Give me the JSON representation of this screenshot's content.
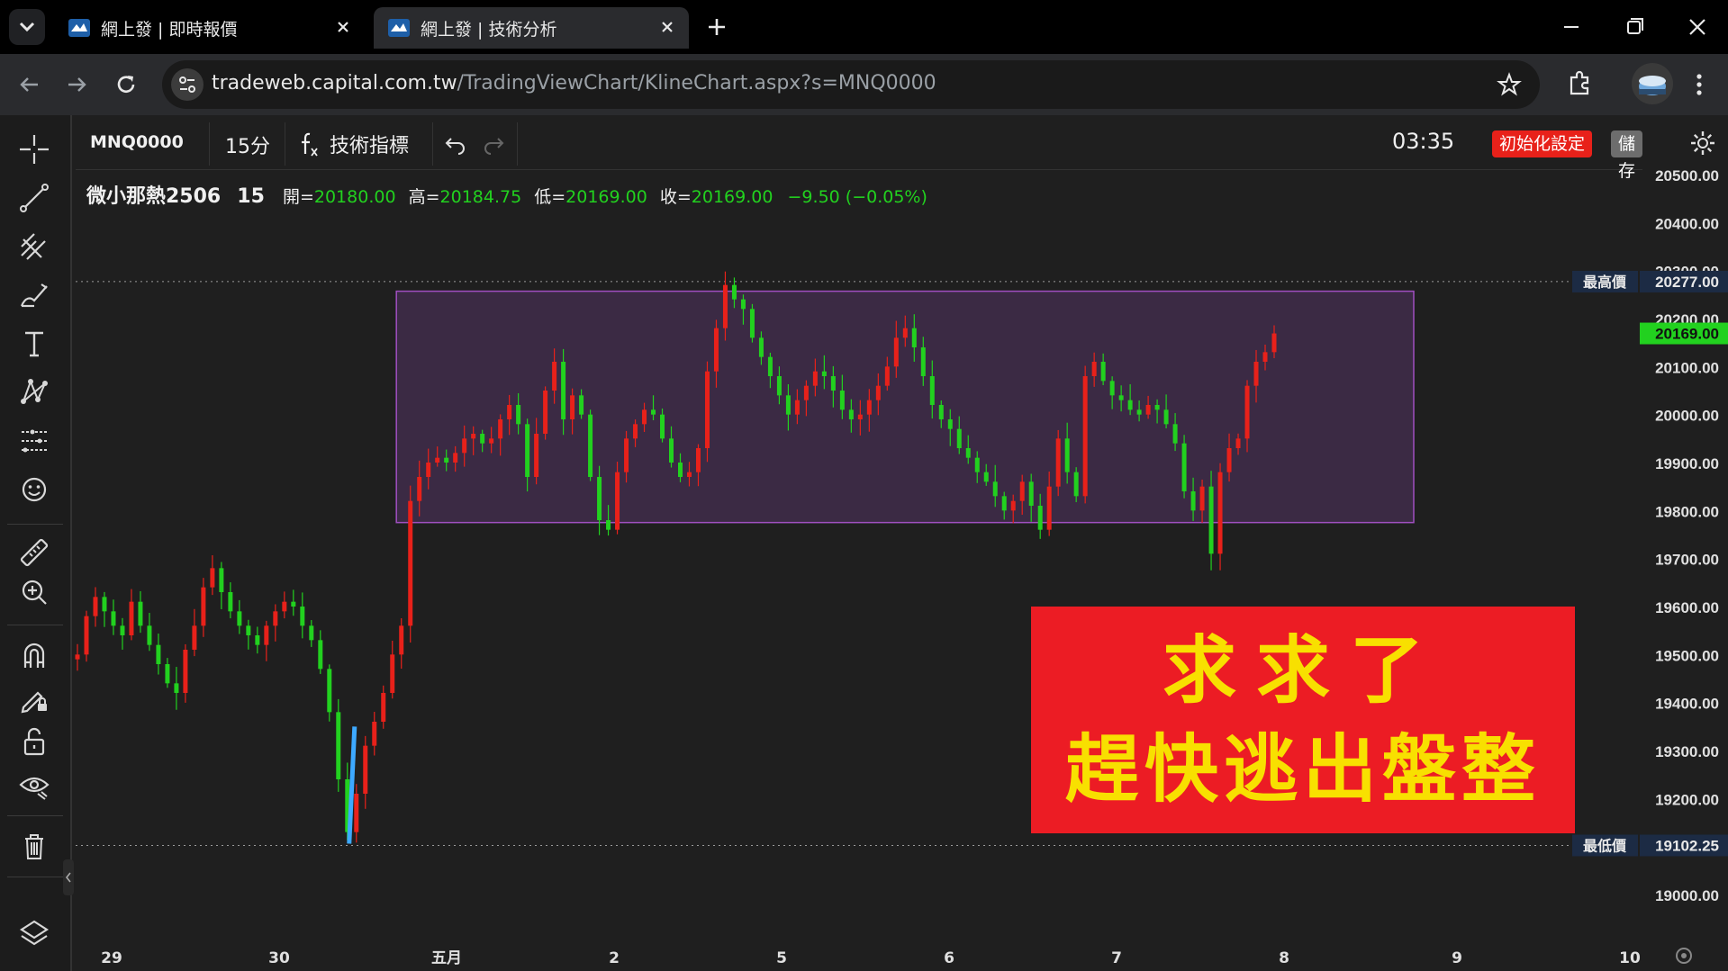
{
  "browser": {
    "tabs": [
      {
        "title": "網上發 | 即時報價",
        "favicon": "capital-logo-icon"
      },
      {
        "title": "網上發 | 技術分析",
        "favicon": "capital-logo-icon",
        "active": true
      }
    ],
    "url_host": "tradeweb.capital.com.tw",
    "url_path": "/TradingViewChart/KlineChart.aspx?s=MNQ0000"
  },
  "toolbar": {
    "symbol": "MNQ0000",
    "interval": "15分",
    "indicators_label": "技術指標",
    "clock": "03:35",
    "reset_label": "初始化設定",
    "save_label": "儲存"
  },
  "legend": {
    "name": "微小那熱2506",
    "interval": "15",
    "open_label": "開=",
    "open": "20180.00",
    "high_label": "高=",
    "high": "20184.75",
    "low_label": "低=",
    "low": "20169.00",
    "close_label": "收=",
    "close": "20169.00",
    "change": "−9.50 (−0.05%)"
  },
  "overlay": {
    "line1": "求求了",
    "line2": "趕快逃出盤整"
  },
  "left_tools": [
    "crosshair-icon",
    "trend-line-icon",
    "fib-tool-icon",
    "brush-icon",
    "text-icon",
    "pattern-icon",
    "forecast-icon",
    "emoji-icon",
    "ruler-icon",
    "zoom-in-icon",
    "magnet-icon",
    "lock-drawing-icon",
    "unlock-icon",
    "eye-icon",
    "trash-icon",
    "layers-icon"
  ],
  "colors": {
    "up": "#e8211a",
    "down": "#22d11f",
    "range_box_fill": "#3b2a44",
    "range_box_border": "#a04fc0",
    "last_price_bg": "#22d11f"
  },
  "chart_data": {
    "type": "candlestick",
    "x_ticks": [
      "29",
      "30",
      "五月",
      "2",
      "5",
      "6",
      "7",
      "8",
      "9",
      "10"
    ],
    "y_ticks": [
      "20500.00",
      "20400.00",
      "20300.00",
      "20200.00",
      "20100.00",
      "20000.00",
      "19900.00",
      "19800.00",
      "19700.00",
      "19600.00",
      "19500.00",
      "19400.00",
      "19300.00",
      "19200.00",
      "19000.00"
    ],
    "ylim": [
      18940,
      20500
    ],
    "high_marker": {
      "label": "最高價",
      "value": "20277.00"
    },
    "low_marker": {
      "label": "最低價",
      "value": "19102.25"
    },
    "last_price": "20169.00",
    "range_box": {
      "top": 20257,
      "bottom": 19775,
      "x_start": "五月",
      "x_end": "9"
    },
    "series_close": [
      19500,
      19580,
      19620,
      19590,
      19560,
      19540,
      19610,
      19560,
      19520,
      19480,
      19440,
      19420,
      19510,
      19560,
      19640,
      19680,
      19630,
      19590,
      19560,
      19540,
      19520,
      19560,
      19590,
      19610,
      19600,
      19560,
      19530,
      19470,
      19380,
      19240,
      19130,
      19210,
      19310,
      19360,
      19420,
      19500,
      19560,
      19820,
      19870,
      19900,
      19910,
      19900,
      19920,
      19950,
      19960,
      19940,
      19950,
      19990,
      20020,
      19980,
      19870,
      19960,
      20050,
      20110,
      19990,
      20040,
      20000,
      19870,
      19780,
      19760,
      19880,
      19950,
      19980,
      20010,
      20000,
      19950,
      19900,
      19870,
      19880,
      19930,
      20090,
      20180,
      20270,
      20240,
      20220,
      20160,
      20120,
      20080,
      20040,
      20000,
      20030,
      20060,
      20090,
      20080,
      20050,
      20010,
      19990,
      20000,
      20030,
      20060,
      20100,
      20160,
      20180,
      20140,
      20080,
      20020,
      19990,
      19970,
      19930,
      19910,
      19880,
      19860,
      19830,
      19800,
      19820,
      19860,
      19810,
      19760,
      19850,
      19950,
      19880,
      19830,
      20080,
      20110,
      20070,
      20040,
      20030,
      20010,
      20000,
      20020,
      20010,
      19980,
      19940,
      19840,
      19800,
      19850,
      19710,
      19880,
      19930,
      19950,
      20060,
      20110,
      20130,
      20169
    ]
  }
}
